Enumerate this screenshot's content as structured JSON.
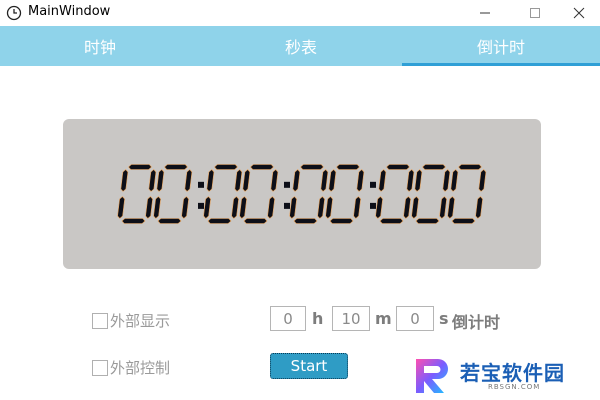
{
  "window": {
    "title": "MainWindow",
    "icon": "clock-icon",
    "controls": [
      "minimize-icon",
      "maximize-icon",
      "close-icon"
    ]
  },
  "tabs": [
    {
      "label": "时钟",
      "active": false
    },
    {
      "label": "秒表",
      "active": false
    },
    {
      "label": "倒计时",
      "active": true
    }
  ],
  "display": {
    "time": "00:00:00:000",
    "digit_color": "#0d0f18",
    "panel_color": "#c9c7c5"
  },
  "options": {
    "external_display": {
      "label": "外部显示",
      "checked": false
    },
    "external_control": {
      "label": "外部控制",
      "checked": false
    }
  },
  "countdown": {
    "hours": "0",
    "hours_unit": "h",
    "minutes": "10",
    "minutes_unit": "m",
    "seconds": "0",
    "seconds_unit": "s",
    "label": "倒计时"
  },
  "start_button": {
    "label": "Start"
  },
  "watermark": {
    "name": "若宝软件园",
    "url": "RBSGN.COM"
  },
  "colors": {
    "tab_bar": "#8fd3ea",
    "tab_active_underline": "#2f9fd6",
    "start_button": "#2f9cc5"
  }
}
